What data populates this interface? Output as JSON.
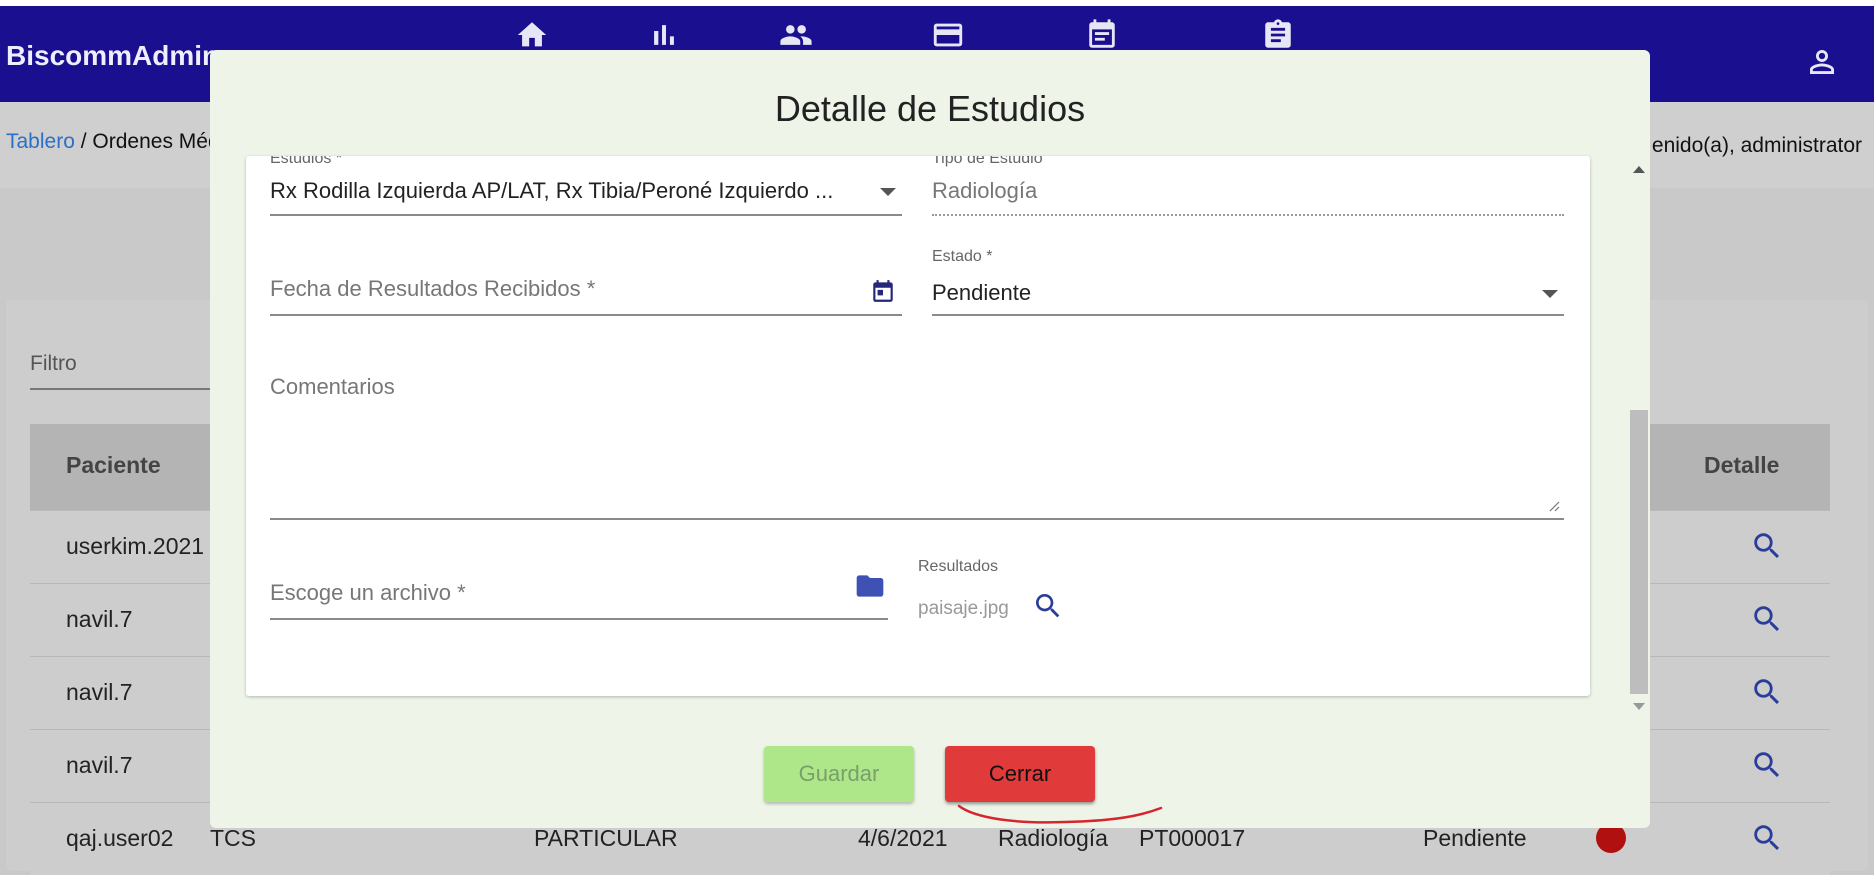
{
  "app": {
    "brand": "BiscommAdmin"
  },
  "nav": {
    "icons": [
      "home-icon",
      "bar-chart-icon",
      "people-icon",
      "credit-card-icon",
      "calendar-icon",
      "clipboard-icon"
    ]
  },
  "breadcrumb": {
    "root": "Tablero",
    "separator": " / ",
    "current": "Ordenes Méd"
  },
  "welcome": "enido(a), administrator",
  "filter": {
    "label": "Filtro"
  },
  "table": {
    "headers": {
      "patient": "Paciente",
      "detail": "Detalle"
    },
    "rows": [
      {
        "patient": "userkim.2021"
      },
      {
        "patient": "navil.7"
      },
      {
        "patient": "navil.7"
      },
      {
        "patient": "navil.7"
      },
      {
        "patient": "qaj.user02",
        "company": "TCS",
        "insurance": "PARTICULAR",
        "date": "4/6/2021",
        "type": "Radiología",
        "code": "PT000017",
        "status": "Pendiente"
      }
    ]
  },
  "modal": {
    "title": "Detalle de Estudios",
    "estudios": {
      "label": "Estudios *",
      "value": "Rx Rodilla Izquierda AP/LAT, Rx Tibia/Peroné Izquierdo ..."
    },
    "tipo": {
      "label": "Tipo de Estudio",
      "value": "Radiología"
    },
    "fecha": {
      "placeholder": "Fecha de Resultados Recibidos *"
    },
    "estado": {
      "label": "Estado *",
      "value": "Pendiente"
    },
    "comentarios": {
      "placeholder": "Comentarios"
    },
    "archivo": {
      "placeholder": "Escoge un archivo *"
    },
    "resultados": {
      "label": "Resultados",
      "file": "paisaje.jpg"
    },
    "buttons": {
      "save": "Guardar",
      "close": "Cerrar"
    }
  },
  "colors": {
    "appbar": "#1a0f8f",
    "modal_bg": "#eef5e8",
    "save": "#aee68a",
    "close": "#e03a3a",
    "status_dot": "#b01010",
    "annotation": "#d6262d"
  }
}
